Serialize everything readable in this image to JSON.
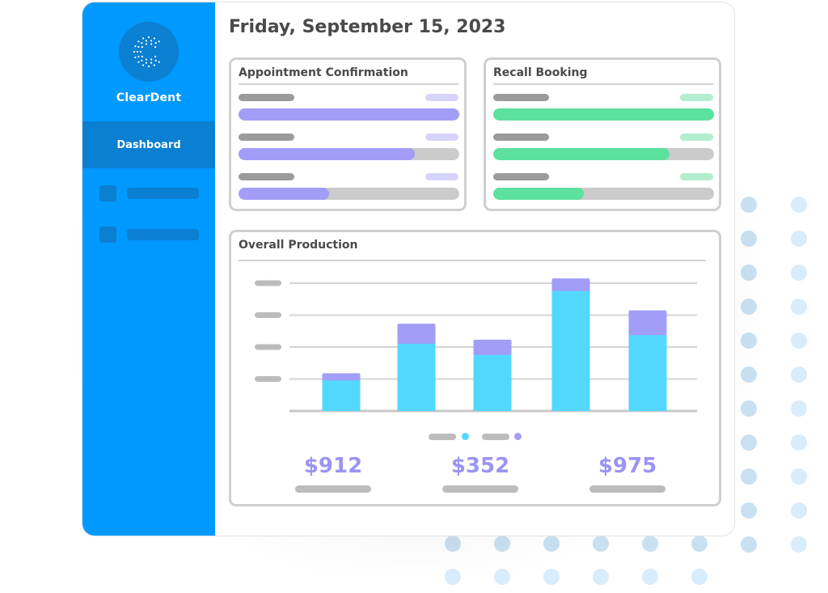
{
  "app": {
    "brand": "ClearDent",
    "logo_icon": "cleardent-dotted-c-logo"
  },
  "sidebar": {
    "active_item": "Dashboard",
    "items": [
      {
        "icon": "placeholder-square-icon",
        "label": ""
      },
      {
        "icon": "placeholder-square-icon",
        "label": ""
      }
    ]
  },
  "header": {
    "date": "Friday, September 15, 2023"
  },
  "colors": {
    "sidebar_bg": "#0099ff",
    "sidebar_active": "#0b7fd1",
    "purple": "#a29df7",
    "purple_light": "#d6d4fb",
    "green": "#5ce19e",
    "green_light": "#b3edd0",
    "cyan": "#53d8fd",
    "track": "#cbcbcb"
  },
  "appointment_confirmation": {
    "title": "Appointment Confirmation",
    "rows": [
      {
        "progress": 1.0
      },
      {
        "progress": 0.8
      },
      {
        "progress": 0.41
      }
    ]
  },
  "recall_booking": {
    "title": "Recall Booking",
    "rows": [
      {
        "progress": 1.0
      },
      {
        "progress": 0.8
      },
      {
        "progress": 0.41
      }
    ]
  },
  "overall_production": {
    "title": "Overall Production",
    "stats": [
      {
        "value": "$912"
      },
      {
        "value": "$352"
      },
      {
        "value": "$975"
      }
    ]
  },
  "chart_data": {
    "type": "bar",
    "stacked": true,
    "title": "Overall Production",
    "categories": [
      "",
      "",
      "",
      "",
      ""
    ],
    "series": [
      {
        "name": "",
        "color": "#53d8fd",
        "values": [
          0.98,
          2.13,
          1.78,
          3.78,
          2.4
        ]
      },
      {
        "name": "",
        "color": "#a29df7",
        "values": [
          0.2,
          0.6,
          0.45,
          0.37,
          0.75
        ]
      }
    ],
    "ylim": [
      0,
      4
    ],
    "yticks": [
      1,
      2,
      3,
      4
    ],
    "ytick_labels_hidden": true,
    "grid": true,
    "legend": "bottom-center",
    "xlabel": "",
    "ylabel": ""
  }
}
